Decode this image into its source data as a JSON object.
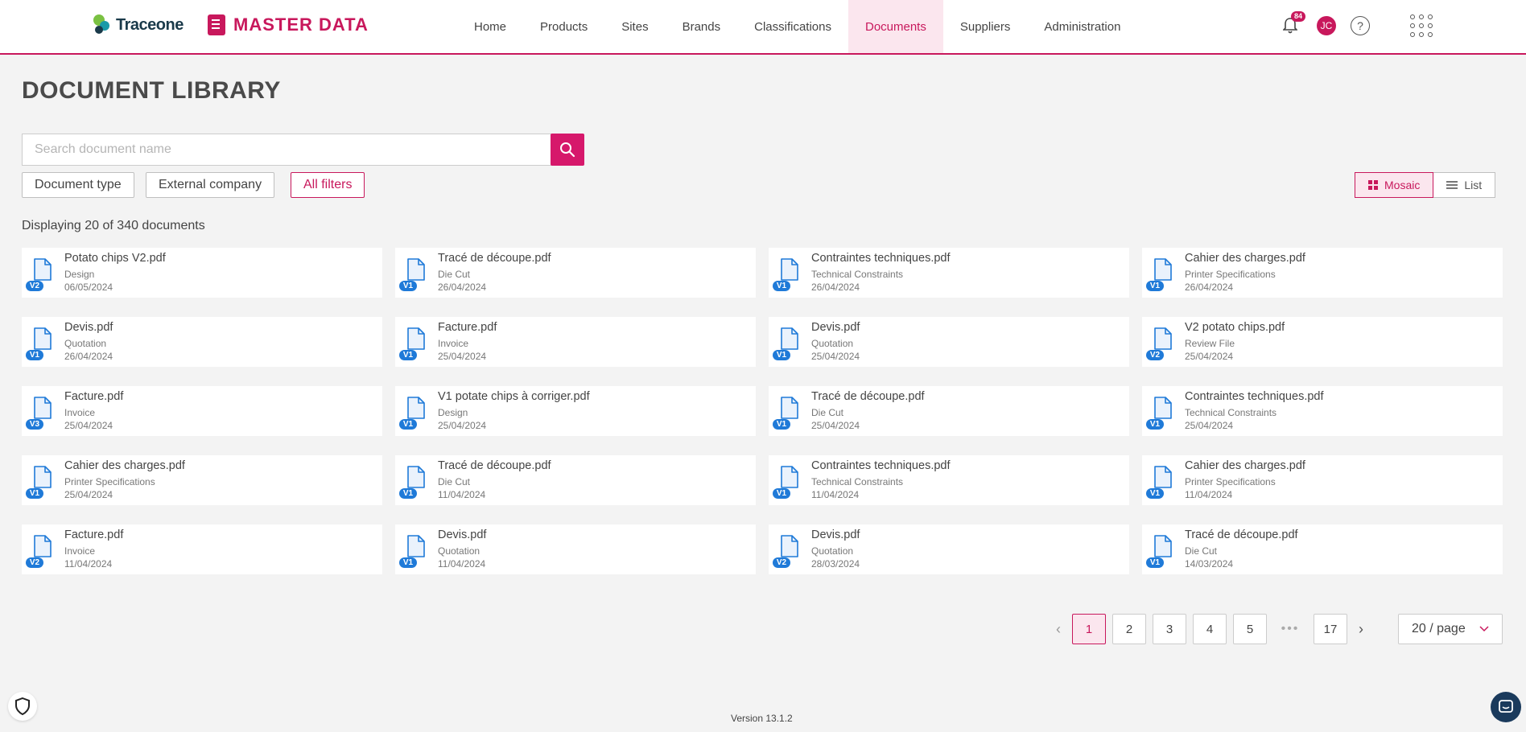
{
  "header": {
    "logo_text": "Traceone",
    "app_title": "MASTER DATA",
    "nav": [
      {
        "label": "Home",
        "active": false
      },
      {
        "label": "Products",
        "active": false
      },
      {
        "label": "Sites",
        "active": false
      },
      {
        "label": "Brands",
        "active": false
      },
      {
        "label": "Classifications",
        "active": false
      },
      {
        "label": "Documents",
        "active": true
      },
      {
        "label": "Suppliers",
        "active": false
      },
      {
        "label": "Administration",
        "active": false
      }
    ],
    "notifications_count": "84",
    "user_initials": "JC",
    "help_label": "?"
  },
  "page": {
    "title": "DOCUMENT LIBRARY",
    "search_placeholder": "Search document name",
    "filters": {
      "document_type": "Document type",
      "external_company": "External company",
      "all_filters": "All filters"
    },
    "view": {
      "mosaic": "Mosaic",
      "list": "List",
      "active": "mosaic"
    },
    "count_text": "Displaying 20 of 340 documents"
  },
  "documents": [
    {
      "name": "Potato chips V2.pdf",
      "type": "Design",
      "date": "06/05/2024",
      "version": "V2"
    },
    {
      "name": "Tracé de découpe.pdf",
      "type": "Die Cut",
      "date": "26/04/2024",
      "version": "V1"
    },
    {
      "name": "Contraintes techniques.pdf",
      "type": "Technical Constraints",
      "date": "26/04/2024",
      "version": "V1"
    },
    {
      "name": "Cahier des charges.pdf",
      "type": "Printer Specifications",
      "date": "26/04/2024",
      "version": "V1"
    },
    {
      "name": "Devis.pdf",
      "type": "Quotation",
      "date": "26/04/2024",
      "version": "V1"
    },
    {
      "name": "Facture.pdf",
      "type": "Invoice",
      "date": "25/04/2024",
      "version": "V1"
    },
    {
      "name": "Devis.pdf",
      "type": "Quotation",
      "date": "25/04/2024",
      "version": "V1"
    },
    {
      "name": "V2 potato chips.pdf",
      "type": "Review File",
      "date": "25/04/2024",
      "version": "V2"
    },
    {
      "name": "Facture.pdf",
      "type": "Invoice",
      "date": "25/04/2024",
      "version": "V3"
    },
    {
      "name": "V1 potate chips à corriger.pdf",
      "type": "Design",
      "date": "25/04/2024",
      "version": "V1"
    },
    {
      "name": "Tracé de découpe.pdf",
      "type": "Die Cut",
      "date": "25/04/2024",
      "version": "V1"
    },
    {
      "name": "Contraintes techniques.pdf",
      "type": "Technical Constraints",
      "date": "25/04/2024",
      "version": "V1"
    },
    {
      "name": "Cahier des charges.pdf",
      "type": "Printer Specifications",
      "date": "25/04/2024",
      "version": "V1"
    },
    {
      "name": "Tracé de découpe.pdf",
      "type": "Die Cut",
      "date": "11/04/2024",
      "version": "V1"
    },
    {
      "name": "Contraintes techniques.pdf",
      "type": "Technical Constraints",
      "date": "11/04/2024",
      "version": "V1"
    },
    {
      "name": "Cahier des charges.pdf",
      "type": "Printer Specifications",
      "date": "11/04/2024",
      "version": "V1"
    },
    {
      "name": "Facture.pdf",
      "type": "Invoice",
      "date": "11/04/2024",
      "version": "V2"
    },
    {
      "name": "Devis.pdf",
      "type": "Quotation",
      "date": "11/04/2024",
      "version": "V1"
    },
    {
      "name": "Devis.pdf",
      "type": "Quotation",
      "date": "28/03/2024",
      "version": "V2"
    },
    {
      "name": "Tracé de découpe.pdf",
      "type": "Die Cut",
      "date": "14/03/2024",
      "version": "V1"
    }
  ],
  "pagination": {
    "pages": [
      "1",
      "2",
      "3",
      "4",
      "5"
    ],
    "current": "1",
    "ellipsis": "•••",
    "last": "17",
    "page_size": "20 / page"
  },
  "footer": {
    "version": "Version 13.1.2"
  },
  "colors": {
    "brand": "#c8185c",
    "version_badge": "#1f7ad8"
  },
  "icons": {
    "search": "search-icon",
    "notifications": "bell-icon",
    "help": "help-icon",
    "apps": "app-grid-icon",
    "document": "file-icon",
    "mosaic": "mosaic-icon",
    "list": "list-icon",
    "shield": "shield-icon",
    "chat": "chat-icon"
  }
}
